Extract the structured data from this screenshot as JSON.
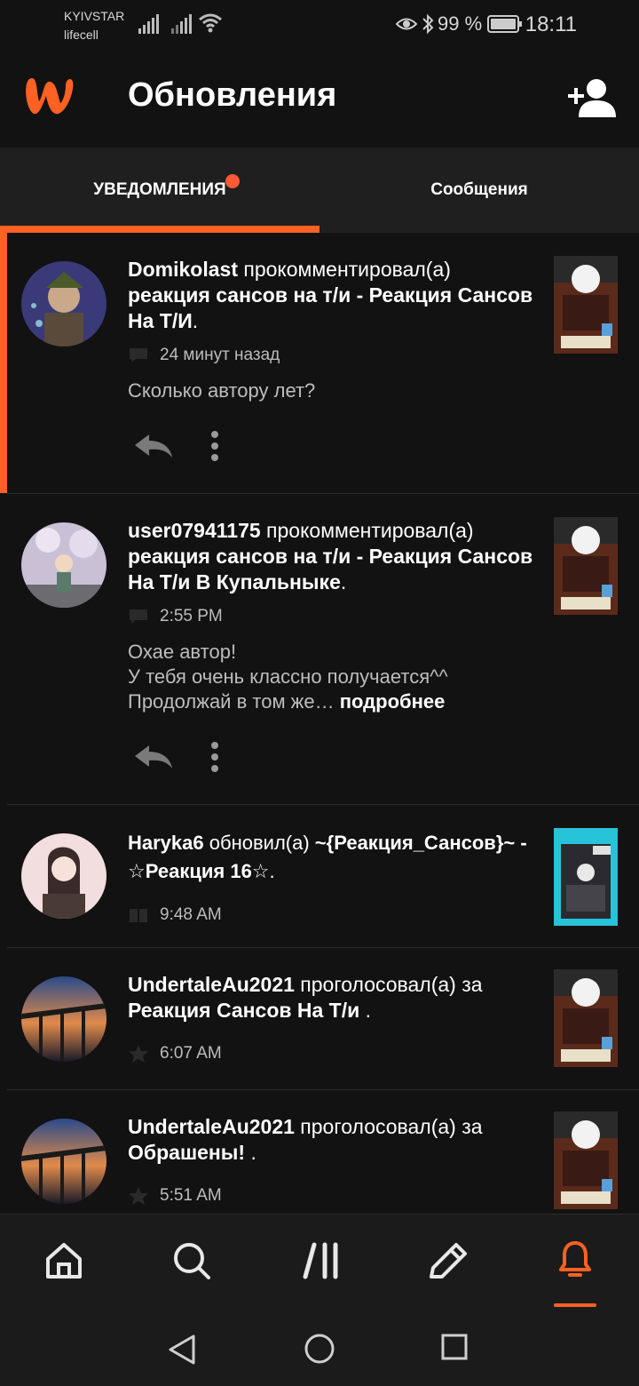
{
  "status_bar": {
    "carrier1": "KYIVSTAR",
    "carrier2": "lifecell",
    "battery": "99 %",
    "time": "18:11",
    "icons": [
      "signal-icon",
      "signal-icon",
      "wifi-icon",
      "eye-icon",
      "bluetooth-icon",
      "battery-icon"
    ]
  },
  "header": {
    "title": "Обновления",
    "logo_icon": "wattpad-logo",
    "action_icon": "add-user-icon"
  },
  "tabs": {
    "notifications": "УВЕДОМЛЕНИЯ",
    "messages": "Сообщения",
    "active": "notifications"
  },
  "notifications": [
    {
      "user": "Domikolast",
      "action": " прокомментировал(а) ",
      "target": "реакция сансов на т/и - Реакция Сансов На Т/И",
      "suffix": ".",
      "time": "24 минут назад",
      "meta_icon": "comment-icon",
      "comment_lines": [
        "Сколько автору лет?"
      ],
      "more": ""
    },
    {
      "user": "user07941175",
      "action": " прокомментировал(а) ",
      "target": "реакция сансов на т/и - Реакция Сансов На Т/и В Купальныке",
      "suffix": ".",
      "time": "2:55 PM",
      "meta_icon": "comment-icon",
      "comment_lines": [
        "Охае автор!",
        "У тебя очень классно получается^^",
        "Продолжай в том же… "
      ],
      "more": "подробнее"
    },
    {
      "user": "Haryka6",
      "action": " обновил(а) ",
      "target": "~{Реакция_Сансов}~ - ☆Реакция 16☆",
      "suffix": ".",
      "time": "9:48 AM",
      "meta_icon": "book-icon"
    },
    {
      "user": "UndertaleAu2021",
      "action": " проголосовал(а) за ",
      "target": "Реакция Сансов На Т/и",
      "suffix": " .",
      "time": "6:07 AM",
      "meta_icon": "star-icon"
    },
    {
      "user": "UndertaleAu2021",
      "action": " проголосовал(а) за ",
      "target": "Обрашены!",
      "suffix": " .",
      "time": "5:51 AM",
      "meta_icon": "star-icon"
    }
  ],
  "bottom_nav": [
    "home-icon",
    "search-icon",
    "library-icon",
    "write-icon",
    "bell-icon"
  ],
  "system_nav": [
    "back-icon",
    "home-circle-icon",
    "recents-icon"
  ],
  "colors": {
    "accent": "#ff6122",
    "background": "#121212",
    "surface": "#1f1f1f"
  }
}
